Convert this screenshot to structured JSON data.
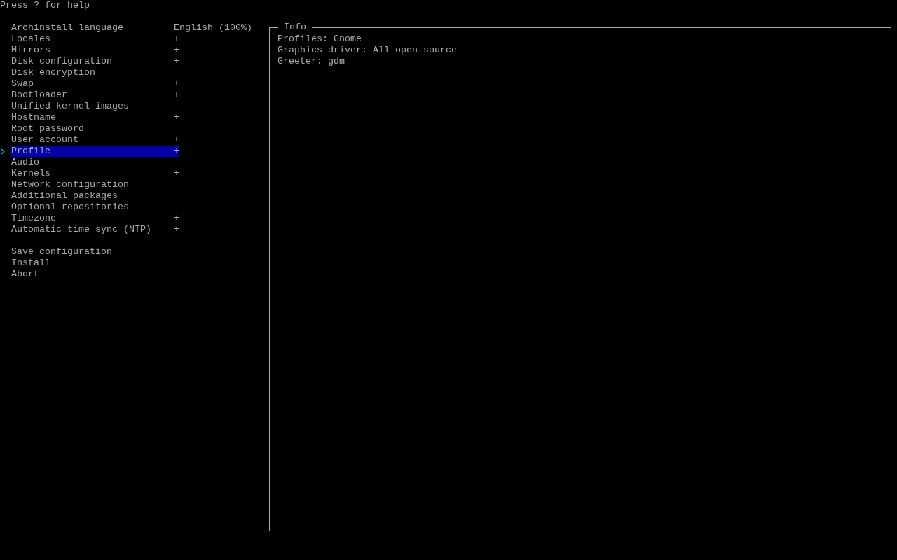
{
  "help_hint": "Press ? for help",
  "menu": [
    {
      "label": "Archinstall language",
      "value": "English (100%)",
      "selected": false
    },
    {
      "label": "Locales",
      "value": "+",
      "selected": false
    },
    {
      "label": "Mirrors",
      "value": "+",
      "selected": false
    },
    {
      "label": "Disk configuration",
      "value": "+",
      "selected": false
    },
    {
      "label": "Disk encryption",
      "selected": false
    },
    {
      "label": "Swap",
      "value": "+",
      "selected": false
    },
    {
      "label": "Bootloader",
      "value": "+",
      "selected": false
    },
    {
      "label": "Unified kernel images",
      "selected": false
    },
    {
      "label": "Hostname",
      "value": "+",
      "selected": false
    },
    {
      "label": "Root password",
      "selected": false
    },
    {
      "label": "User account",
      "value": "+",
      "selected": false
    },
    {
      "label": "Profile",
      "value": "+",
      "selected": true
    },
    {
      "label": "Audio",
      "selected": false
    },
    {
      "label": "Kernels",
      "value": "+",
      "selected": false
    },
    {
      "label": "Network configuration",
      "selected": false
    },
    {
      "label": "Additional packages",
      "selected": false
    },
    {
      "label": "Optional repositories",
      "selected": false
    },
    {
      "label": "Timezone",
      "value": "+",
      "selected": false
    },
    {
      "label": "Automatic time sync (NTP)",
      "value": "+",
      "selected": false
    }
  ],
  "actions": [
    {
      "label": "Save configuration",
      "selected": false
    },
    {
      "label": "Install",
      "selected": false
    },
    {
      "label": "Abort",
      "selected": false
    }
  ],
  "info": {
    "title": "Info",
    "lines": [
      "Profiles: Gnome",
      "Graphics driver: All open-source",
      "Greeter: gdm"
    ]
  }
}
